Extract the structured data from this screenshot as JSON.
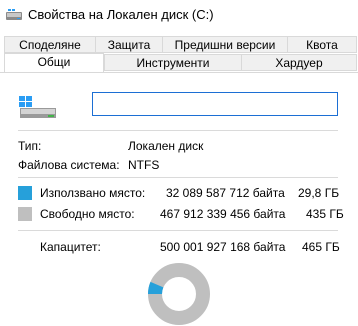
{
  "window": {
    "title": "Свойства на Локален диск (C:)"
  },
  "tabs": {
    "row1": [
      "Споделяне",
      "Защита",
      "Предишни версии",
      "Квота"
    ],
    "row2": [
      "Общи",
      "Инструменти",
      "Хардуер"
    ],
    "active": "Общи"
  },
  "general": {
    "drive_name_value": "",
    "type_label": "Тип:",
    "type_value": "Локален диск",
    "fs_label": "Файлова система:",
    "fs_value": "NTFS",
    "used_label": "Използвано място:",
    "used_bytes": "32 089 587 712 байта",
    "used_size": "29,8 ГБ",
    "free_label": "Свободно място:",
    "free_bytes": "467 912 339 456 байта",
    "free_size": "435 ГБ",
    "capacity_label": "Капацитет:",
    "capacity_bytes": "500 001 927 168 байта",
    "capacity_size": "465 ГБ",
    "used_fraction": 0.064
  },
  "colors": {
    "used": "#26a0da",
    "free": "#bfbfbf",
    "focus": "#1c6fd4"
  },
  "icons": {
    "title": "drive-icon",
    "drive": "drive-icon"
  }
}
